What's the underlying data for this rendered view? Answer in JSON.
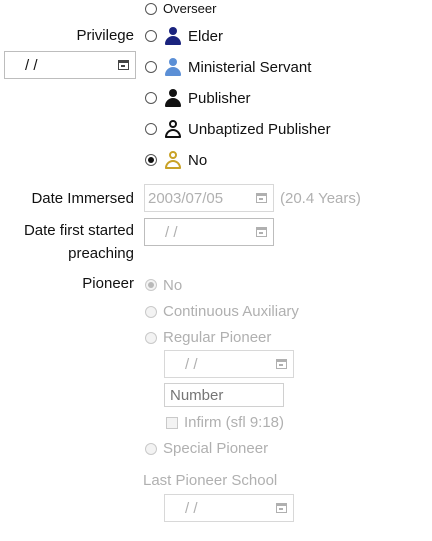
{
  "privilege": {
    "label": "Privilege",
    "date_value": "/ /",
    "options": [
      {
        "label": "Overseer",
        "icon": "none",
        "checked": false
      },
      {
        "label": "Elder",
        "icon": "elder-icon",
        "color": "#1a237e",
        "checked": false
      },
      {
        "label": "Ministerial Servant",
        "icon": "ministerial-servant-icon",
        "color": "#5b8fd6",
        "checked": false
      },
      {
        "label": "Publisher",
        "icon": "publisher-icon",
        "color": "#111111",
        "checked": false
      },
      {
        "label": "Unbaptized Publisher",
        "icon": "unbaptized-publisher-icon",
        "color": "#111111",
        "checked": false
      },
      {
        "label": "No",
        "icon": "no-privilege-icon",
        "color": "#c9a227",
        "checked": true
      }
    ]
  },
  "date_immersed": {
    "label": "Date Immersed",
    "value": "2003/07/05",
    "years": "(20.4 Years)"
  },
  "date_first_preaching": {
    "label_line1": "Date first started",
    "label_line2": "preaching",
    "value": "/ /"
  },
  "pioneer": {
    "label": "Pioneer",
    "options": [
      {
        "label": "No",
        "checked": true
      },
      {
        "label": "Continuous Auxiliary",
        "checked": false
      },
      {
        "label": "Regular Pioneer",
        "checked": false
      }
    ],
    "regular_date_value": "/ /",
    "number_placeholder": "Number",
    "infirm_label": "Infirm (sfl 9:18)",
    "special_label": "Special Pioneer",
    "last_school_label": "Last Pioneer School",
    "last_school_date_value": "/ /"
  }
}
